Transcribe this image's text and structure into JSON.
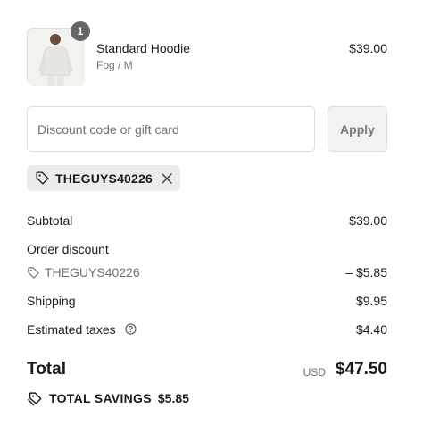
{
  "product": {
    "image_icon": "hoodie-photo",
    "quantity_badge": "1",
    "name": "Standard Hoodie",
    "variant": "Fog / M",
    "price": "$39.00"
  },
  "discount": {
    "placeholder": "Discount code or gift card",
    "apply_label": "Apply",
    "applied_code": "THEGUYS40226",
    "remove_icon": "close-icon"
  },
  "summary": {
    "subtotal_label": "Subtotal",
    "subtotal_value": "$39.00",
    "order_discount_label": "Order discount",
    "order_discount_code": "THEGUYS40226",
    "order_discount_value": "– $5.85",
    "shipping_label": "Shipping",
    "shipping_value": "$9.95",
    "taxes_label": "Estimated taxes",
    "taxes_value": "$4.40",
    "total_label": "Total",
    "total_currency": "USD",
    "total_value": "$47.50",
    "savings_label": "TOTAL SAVINGS",
    "savings_value": "$5.85"
  },
  "colors": {
    "badge": "#666666",
    "chip_bg": "#ececec",
    "muted_text": "#707070",
    "border": "#dedede"
  }
}
